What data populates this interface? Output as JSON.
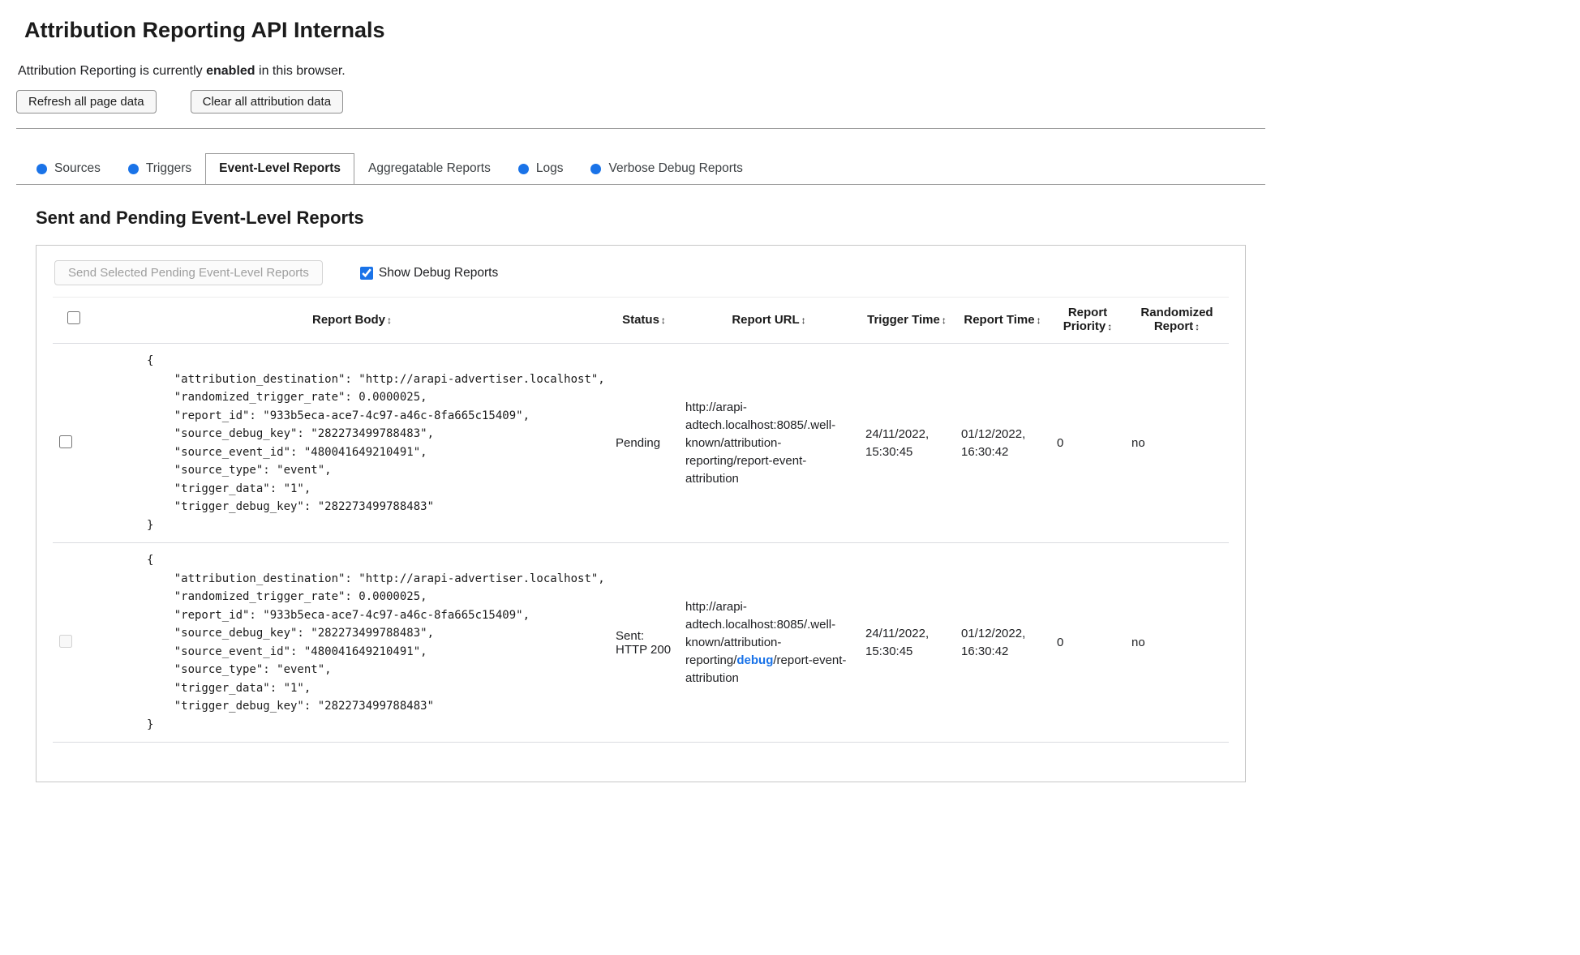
{
  "page": {
    "title": "Attribution Reporting API Internals",
    "status": {
      "prefix": "Attribution Reporting is currently ",
      "emphasis": "enabled",
      "suffix": " in this browser."
    },
    "buttons": {
      "refresh": "Refresh all page data",
      "clear": "Clear all attribution data"
    }
  },
  "tabs": [
    {
      "label": "Sources"
    },
    {
      "label": "Triggers"
    },
    {
      "label": "Event-Level Reports"
    },
    {
      "label": "Aggregatable Reports"
    },
    {
      "label": "Logs"
    },
    {
      "label": "Verbose Debug Reports"
    }
  ],
  "section": {
    "heading": "Sent and Pending Event-Level Reports",
    "send_button": "Send Selected Pending Event-Level Reports",
    "show_debug": "Show Debug Reports"
  },
  "table": {
    "sort_icon": "↕",
    "headers": {
      "body": "Report Body",
      "status": "Status",
      "url": "Report URL",
      "trigger_time": "Trigger Time",
      "report_time": "Report Time",
      "priority": "Report Priority",
      "randomized": "Randomized Report"
    },
    "rows": [
      {
        "body": "{\n    \"attribution_destination\": \"http://arapi-advertiser.localhost\",\n    \"randomized_trigger_rate\": 0.0000025,\n    \"report_id\": \"933b5eca-ace7-4c97-a46c-8fa665c15409\",\n    \"source_debug_key\": \"282273499788483\",\n    \"source_event_id\": \"480041649210491\",\n    \"source_type\": \"event\",\n    \"trigger_data\": \"1\",\n    \"trigger_debug_key\": \"282273499788483\"\n}",
        "status": "Pending",
        "url_pre": "http://arapi-adtech.localhost:8085/.well-known/attribution-reporting/report-event-attribution",
        "url_highlight": "",
        "url_post": "",
        "trigger_time": "24/11/2022, 15:30:45",
        "report_time": "01/12/2022, 16:30:42",
        "priority": "0",
        "randomized": "no"
      },
      {
        "body": "{\n    \"attribution_destination\": \"http://arapi-advertiser.localhost\",\n    \"randomized_trigger_rate\": 0.0000025,\n    \"report_id\": \"933b5eca-ace7-4c97-a46c-8fa665c15409\",\n    \"source_debug_key\": \"282273499788483\",\n    \"source_event_id\": \"480041649210491\",\n    \"source_type\": \"event\",\n    \"trigger_data\": \"1\",\n    \"trigger_debug_key\": \"282273499788483\"\n}",
        "status": "Sent: HTTP 200",
        "url_pre": "http://arapi-adtech.localhost:8085/.well-known/attribution-reporting/",
        "url_highlight": "debug",
        "url_post": "/report-event-attribution",
        "trigger_time": "24/11/2022, 15:30:45",
        "report_time": "01/12/2022, 16:30:42",
        "priority": "0",
        "randomized": "no"
      }
    ]
  },
  "colors": {
    "accent_blue": "#1a73e8"
  }
}
